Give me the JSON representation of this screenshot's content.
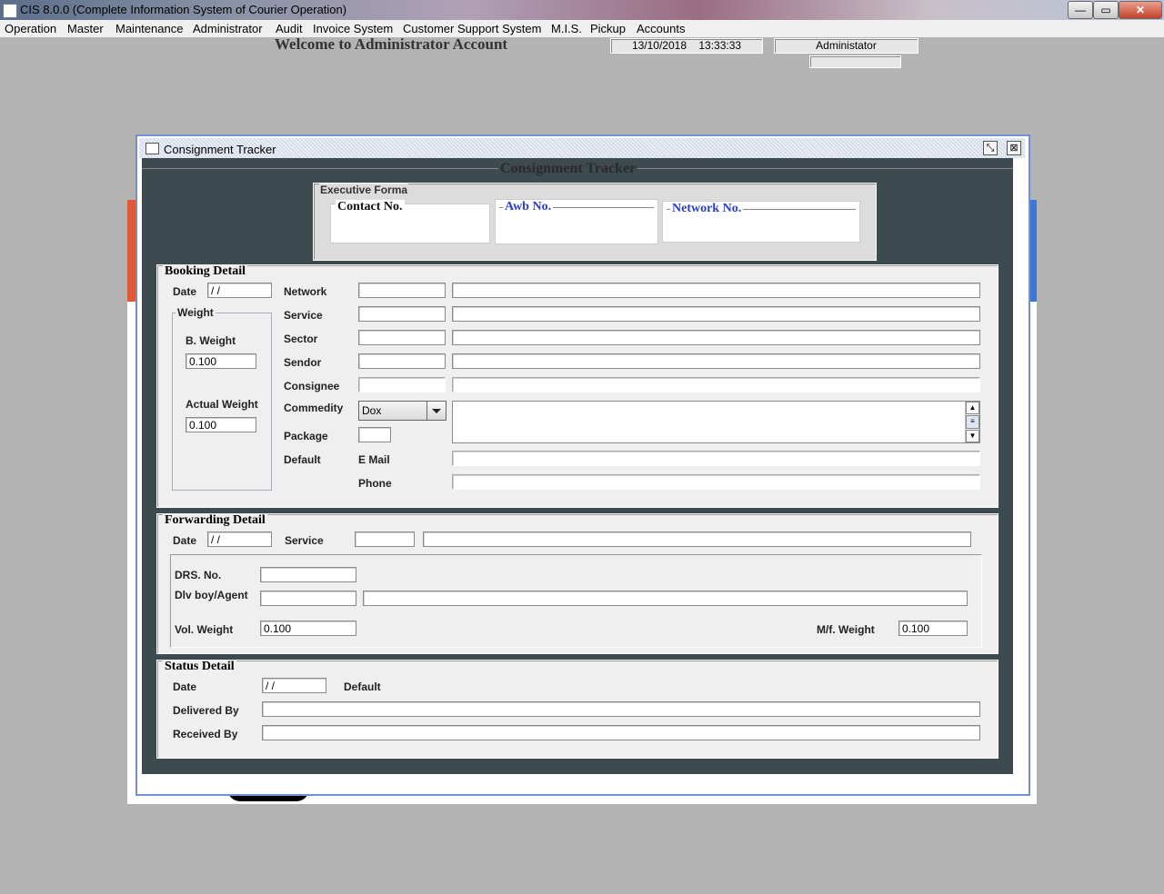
{
  "app": {
    "title": "CIS 8.0.0 (Complete Information System of Courier Operation)",
    "win_buttons": {
      "minimize": "—",
      "restore": "▭",
      "close": "✕"
    }
  },
  "menu": [
    {
      "label": "Operation"
    },
    {
      "label": "Master"
    },
    {
      "label": "Maintenance"
    },
    {
      "label": "Administrator"
    },
    {
      "label": "Audit"
    },
    {
      "label": "Invoice System"
    },
    {
      "label": "Customer Support System"
    },
    {
      "label": "M.I.S."
    },
    {
      "label": "Pickup"
    },
    {
      "label": "Accounts"
    }
  ],
  "header": {
    "welcome": "Welcome to Administrator Account",
    "date": "13/10/2018",
    "time": "13:33:33",
    "user": "Administator"
  },
  "tracker": {
    "window_title": "Consignment Tracker",
    "heading": "Consignment Tracker",
    "btn_restore": "⤡",
    "btn_close": "⊠",
    "executive": {
      "legend": "Executive Forma",
      "contact": {
        "label": "Contact No.",
        "value": ""
      },
      "awb": {
        "label": "Awb No.",
        "value": ""
      },
      "network": {
        "label": "Network No.",
        "value": ""
      }
    },
    "booking": {
      "legend": "Booking Detail",
      "date_label": "Date",
      "date_value": " / /",
      "weight_legend": "Weight",
      "b_weight_label": "B. Weight",
      "b_weight_value": "0.100",
      "actual_weight_label": "Actual Weight",
      "actual_weight_value": "0.100",
      "network_label": "Network",
      "service_label": "Service",
      "sector_label": "Sector",
      "sendor_label": "Sendor",
      "consignee_label": "Consignee",
      "commodity_label": "Commedity",
      "commodity_value": "Dox",
      "package_label": "Package",
      "default_label": "Default",
      "email_label": "E Mail",
      "phone_label": "Phone"
    },
    "forwarding": {
      "legend": "Forwarding Detail",
      "date_label": "Date",
      "date_value": " / /",
      "service_label": "Service",
      "drs_label": "DRS. No.",
      "dlv_label": "Dlv boy/Agent",
      "vol_weight_label": "Vol. Weight",
      "vol_weight_value": "0.100",
      "mf_weight_label": "M/f. Weight",
      "mf_weight_value": "0.100"
    },
    "status": {
      "legend": "Status Detail",
      "date_label": "Date",
      "date_value": " / /",
      "default_label": "Default",
      "delivered_label": "Delivered By",
      "received_label": "Received By"
    }
  }
}
